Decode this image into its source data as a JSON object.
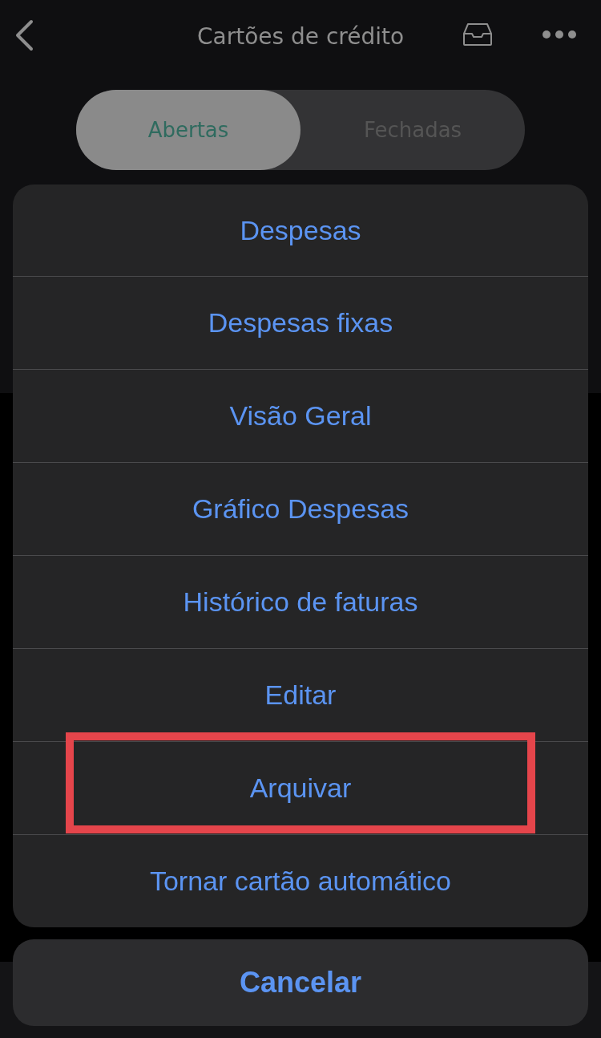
{
  "header": {
    "title": "Cartões de crédito"
  },
  "segments": [
    {
      "label": "Abertas",
      "selected": true
    },
    {
      "label": "Fechadas",
      "selected": false
    }
  ],
  "action_sheet": {
    "items": [
      {
        "label": "Despesas",
        "highlighted": false
      },
      {
        "label": "Despesas fixas",
        "highlighted": false
      },
      {
        "label": "Visão Geral",
        "highlighted": false
      },
      {
        "label": "Gráfico Despesas",
        "highlighted": false
      },
      {
        "label": "Histórico de faturas",
        "highlighted": false
      },
      {
        "label": "Editar",
        "highlighted": false
      },
      {
        "label": "Arquivar",
        "highlighted": true
      },
      {
        "label": "Tornar cartão automático",
        "highlighted": false
      }
    ],
    "cancel": "Cancelar"
  }
}
